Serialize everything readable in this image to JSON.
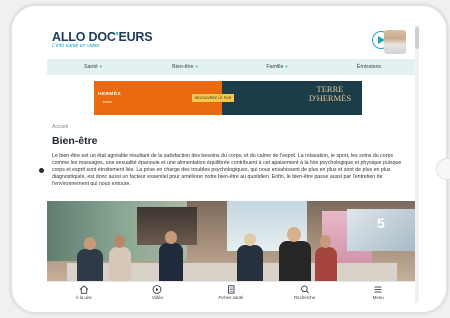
{
  "header": {
    "logo_main": "ALLO DOC",
    "logo_dot": "'",
    "logo_end": "EURS",
    "tagline": "L'info santé en vidéo"
  },
  "nav": {
    "items": [
      {
        "label": "Santé",
        "has_chevron": true
      },
      {
        "label": "Bien-être",
        "has_chevron": true
      },
      {
        "label": "Famille",
        "has_chevron": true
      },
      {
        "label": "Émissions",
        "has_chevron": false
      }
    ],
    "chevron_glyph": "▾"
  },
  "ad": {
    "brand": "HERMÈS",
    "brand_sub": "PARIS",
    "cta": "DÉCOUVREZ LE PUR",
    "title_line1": "TERRE",
    "title_line2": "D'HERMÈS"
  },
  "article": {
    "breadcrumb": "Accueil",
    "title": "Bien-être",
    "body": "Le bien-être est un état agréable résultant de la satisfaction des besoins du corps, et du calme de l'esprit. La relaxation, le sport, les soins du corps comme les massages, une sexualité épanouie et une alimentation équilibrée contribuent à cet apaisement à la fois psychologique et physique puisque corps et esprit sont étroitement liés. La prise en charge des troubles psychologiques, qui nous envahissent de plus en plus et sont de plus en plus diagnostiqués, est donc aussi un facteur essentiel pour améliorer notre bien-être au quotidien. Enfin, le bien-être passe aussi par l'entretien de l'environnement qui nous entoure."
  },
  "video": {
    "channel_mark": "5"
  },
  "bottom_bar": {
    "tabs": [
      {
        "label": "À la une",
        "icon": "home-icon"
      },
      {
        "label": "Vidéo",
        "icon": "play-circle-icon"
      },
      {
        "label": "Fiches santé",
        "icon": "document-icon"
      },
      {
        "label": "Recherche",
        "icon": "search-icon"
      },
      {
        "label": "Menu",
        "icon": "hamburger-menu-icon"
      }
    ]
  },
  "colors": {
    "brand_navy": "#1e3c5a",
    "brand_teal": "#19a9bd",
    "nav_background": "#e3f1f1",
    "ad_orange": "#ea6a10"
  }
}
